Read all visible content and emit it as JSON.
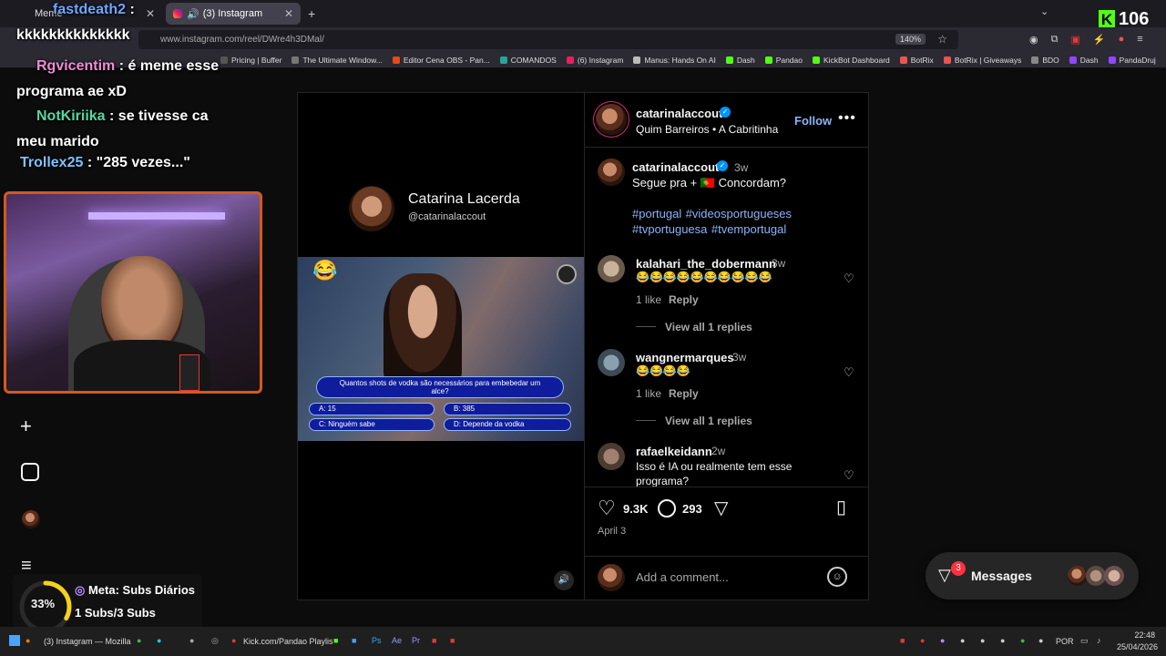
{
  "browser": {
    "tabs": [
      {
        "label": "Meme",
        "active": false
      },
      {
        "label": "(3) Instagram",
        "active": true
      }
    ],
    "url": "www.instagram.com/reel/DWre4h3DMal/",
    "zoom": "140%",
    "bookmarks": [
      "Pricing | Buffer",
      "The Ultimate Window...",
      "Editor Cena OBS - Pan...",
      "COMANDOS",
      "(6) Instagram",
      "Manus: Hands On AI",
      "Dash",
      "Pandao",
      "KickBot Dashboard",
      "BotRix",
      "BotRix | Giveaways",
      "BDO",
      "Dash",
      "PandaDruj"
    ]
  },
  "stream": {
    "kick_viewers": "106",
    "chat": [
      {
        "user": "fastdeath2",
        "text": ":",
        "color": "#6fa8ff"
      },
      {
        "user": "",
        "text": "kkkkkkkkkkkkkk",
        "color": "#ffffff"
      },
      {
        "user": "Rgvicentim",
        "text": ": é meme esse programa ae xD",
        "color": "#f08bd6"
      },
      {
        "user": "NotKiriika",
        "text": ": se tivesse ca meu marido",
        "color": "#53d8a0"
      },
      {
        "user": "Trollex25",
        "text": ": \"285 vezes...\"",
        "color": "#7ec2ff"
      }
    ],
    "goal": {
      "percent": "33%",
      "title": "Meta: Subs Diários",
      "subs": "1 Subs/3 Subs",
      "progress": 0.33
    }
  },
  "video": {
    "channel_name": "Catarina Lacerda",
    "channel_handle": "@catarinalaccout",
    "question": "Quantos shots de vodka são necessários para embebedar um alce?",
    "answers": [
      "A: 15",
      "B: 385",
      "C: Ninguém sabe",
      "D: Depende da vodka"
    ]
  },
  "post": {
    "username": "catarinalaccout",
    "audio": "Quim Barreiros • A Cabritinha",
    "follow": "Follow",
    "caption_age": "3w",
    "caption": "Segue pra + 🇵🇹 Concordam?",
    "hashtags": [
      "#portugal",
      "#videosportugueses",
      "#tvportuguesa",
      "#tvemportugal"
    ],
    "comments": [
      {
        "user": "kalahari_the_dobermann",
        "age": "3w",
        "text": "😂😂😂😂😂😂😂😂😂😂",
        "likes": "1 like",
        "reply": "Reply",
        "replies": "View all 1 replies"
      },
      {
        "user": "wangnermarques",
        "age": "3w",
        "text": "😂😂😂😂",
        "likes": "1 like",
        "reply": "Reply",
        "replies": "View all 1 replies"
      },
      {
        "user": "rafaelkeidann",
        "age": "2w",
        "text": "Isso é IA ou realmente tem esse programa?"
      }
    ],
    "like_count": "9.3K",
    "comment_count": "293",
    "date": "April 3",
    "add_comment_placeholder": "Add a comment..."
  },
  "messages": {
    "label": "Messages",
    "badge": "3"
  },
  "taskbar": {
    "items": [
      "(3) Instagram — Mozilla",
      "Kick.com/Pandao Playlis"
    ],
    "lang": "POR",
    "time": "22:48",
    "date": "25/04/2026"
  }
}
